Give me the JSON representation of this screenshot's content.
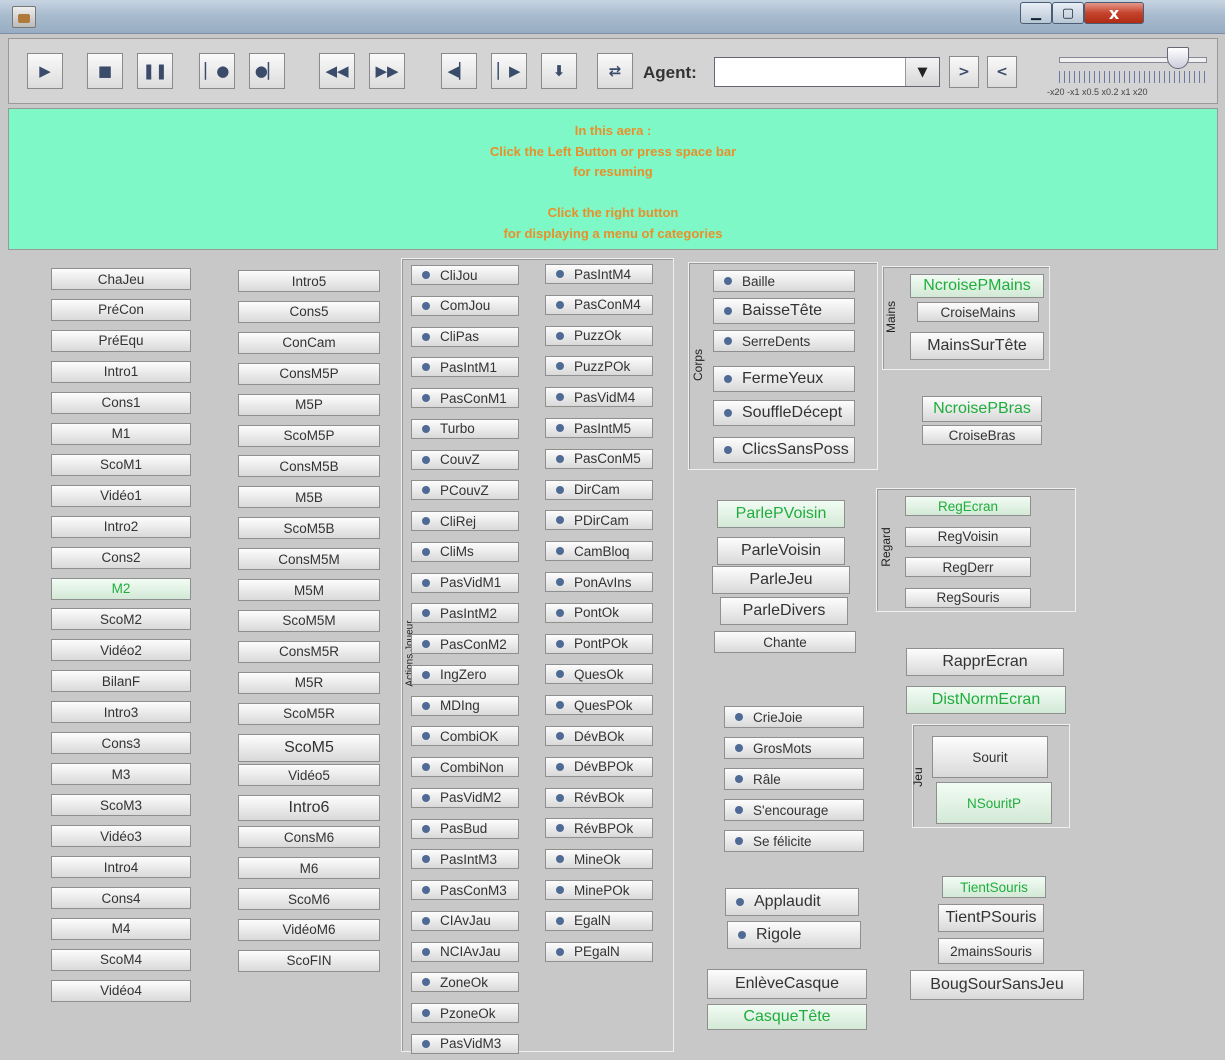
{
  "window": {
    "title": "",
    "close": "x"
  },
  "toolbar": {
    "buttons": [
      {
        "id": "play",
        "glyph": "▶"
      },
      {
        "id": "stop",
        "glyph": "■"
      },
      {
        "id": "pause",
        "glyph": "❚❚"
      },
      {
        "id": "begin",
        "glyph": "▏●"
      },
      {
        "id": "end",
        "glyph": "●▏"
      },
      {
        "id": "rewind",
        "glyph": "◀◀"
      },
      {
        "id": "fastforward",
        "glyph": "▶▶"
      },
      {
        "id": "step-back",
        "glyph": "◀▏"
      },
      {
        "id": "step-forward",
        "glyph": "▏▶"
      },
      {
        "id": "down",
        "glyph": "⬇"
      },
      {
        "id": "swap",
        "glyph": "⇄"
      }
    ],
    "agent_label": "Agent:",
    "agent_value": "",
    "next_label": ">",
    "prev_label": "<",
    "speed_labels": "-x20  -x1 x0.5 x0.2 x1  x20"
  },
  "info": {
    "lines": [
      "In this aera :",
      "Click the Left Button or press space bar",
      "for resuming",
      "",
      "Click the right button",
      "for displaying a menu of categories"
    ]
  },
  "col1": [
    "ChaJeu",
    "PréCon",
    "PréEqu",
    "Intro1",
    "Cons1",
    "M1",
    "ScoM1",
    "Vidéo1",
    "Intro2",
    "Cons2",
    "M2",
    "ScoM2",
    "Vidéo2",
    "BilanF",
    "Intro3",
    "Cons3",
    "M3",
    "ScoM3",
    "Vidéo3",
    "Intro4",
    "Cons4",
    "M4",
    "ScoM4",
    "Vidéo4"
  ],
  "col2": [
    "Intro5",
    "Cons5",
    "ConCam",
    "ConsM5P",
    "M5P",
    "ScoM5P",
    "ConsM5B",
    "M5B",
    "ScoM5B",
    "ConsM5M",
    "M5M",
    "ScoM5M",
    "ConsM5R",
    "M5R",
    "ScoM5R",
    "ScoM5",
    "Vidéo5",
    "Intro6",
    "ConsM6",
    "M6",
    "ScoM6",
    "VidéoM6",
    "ScoFIN"
  ],
  "actions_label": "Actions Joueur",
  "actions_left": [
    "CliJou",
    "ComJou",
    "CliPas",
    "PasIntM1",
    "PasConM1",
    "Turbo",
    "CouvZ",
    "PCouvZ",
    "CliRej",
    "CliMs",
    "PasVidM1",
    "PasIntM2",
    "PasConM2",
    "IngZero",
    "MDIng",
    "CombiOK",
    "CombiNon",
    "PasVidM2",
    "PasBud",
    "PasIntM3",
    "PasConM3",
    "CIAvJau",
    "NCIAvJau",
    "ZoneOk",
    "PzoneOk",
    "PasVidM3"
  ],
  "actions_right": [
    "PasIntM4",
    "PasConM4",
    "PuzzOk",
    "PuzzPOk",
    "PasVidM4",
    "PasIntM5",
    "PasConM5",
    "DirCam",
    "PDirCam",
    "CamBloq",
    "PonAvIns",
    "PontOk",
    "PontPOk",
    "QuesOk",
    "QuesPOk",
    "DévBOk",
    "DévBPOk",
    "RévBOk",
    "RévBPOk",
    "MineOk",
    "MinePOk",
    "EgalN",
    "PEgalN"
  ],
  "corps": {
    "label": "Corps",
    "items": [
      "Baille",
      "BaisseTête",
      "SerreDents",
      "FermeYeux",
      "SouffleDécept",
      "ClicsSansPoss"
    ]
  },
  "mains": {
    "label": "Mains",
    "items": [
      "NcroisePMains",
      "CroiseMains",
      "MainsSurTête"
    ]
  },
  "bras": [
    "NcroisePBras",
    "CroiseBras"
  ],
  "parle": [
    "ParlePVoisin",
    "ParleVoisin",
    "ParleJeu",
    "ParleDivers",
    "Chante"
  ],
  "regard": {
    "label": "Regard",
    "items": [
      "RegEcran",
      "RegVoisin",
      "RegDerr",
      "RegSouris"
    ]
  },
  "ecran": [
    "RapprEcran",
    "DistNormEcran"
  ],
  "voix": [
    "CrieJoie",
    "GrosMots",
    "Râle",
    "S'encourage",
    "Se félicite"
  ],
  "jeu": {
    "label": "Jeu",
    "items": [
      "Sourit",
      "NSouritP"
    ]
  },
  "reactions": [
    "Applaudit",
    "Rigole"
  ],
  "tient": [
    "TientSouris",
    "TientPSouris",
    "2mainsSouris"
  ],
  "casque": [
    "EnlèveCasque",
    "CasqueTête"
  ],
  "bouge": "BougSourSansJeu"
}
